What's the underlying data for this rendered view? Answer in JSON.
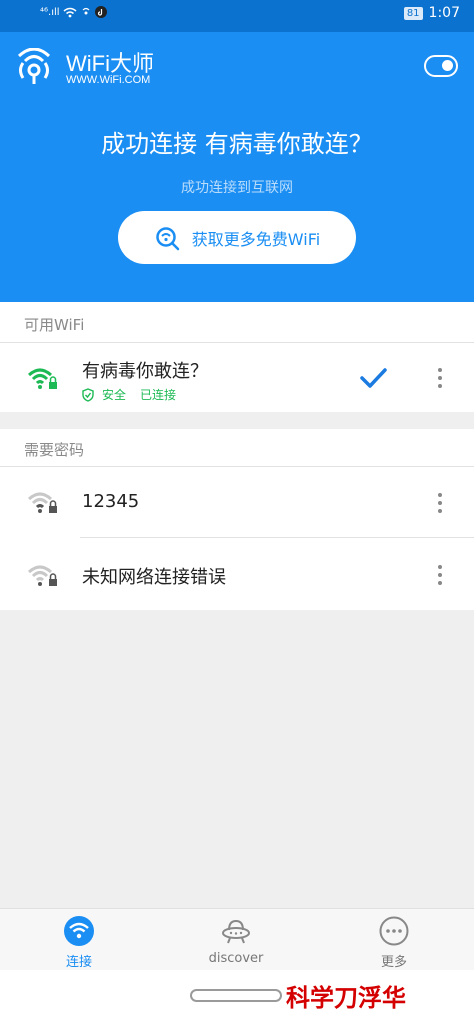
{
  "status_bar": {
    "signal": "⁴⁶.ıll",
    "battery": "81",
    "time": "1:07"
  },
  "header": {
    "brand_name": "WiFi大师",
    "brand_url": "WWW.WiFi.COM",
    "headline": "成功连接 有病毒你敢连？",
    "subline": "成功连接到互联网",
    "more_wifi_button": "获取更多免费WiFi"
  },
  "available_section": {
    "label": "可用WiFi",
    "networks": [
      {
        "name": "有病毒你敢连？",
        "security": "安全",
        "status": "已连接"
      }
    ]
  },
  "password_section": {
    "label": "需要密码",
    "networks": [
      {
        "name": "12345"
      },
      {
        "name": "未知网络连接错误"
      }
    ]
  },
  "tabs": [
    {
      "label": "连接",
      "icon": "wifi-icon",
      "active": true
    },
    {
      "label": "discover",
      "icon": "ufo-icon",
      "active": false
    },
    {
      "label": "更多",
      "icon": "more-circle-icon",
      "active": false
    }
  ],
  "watermark": "科学刀浮华",
  "colors": {
    "primary": "#1b8ef3",
    "status_bar": "#0c72cf",
    "success": "#1db954"
  }
}
